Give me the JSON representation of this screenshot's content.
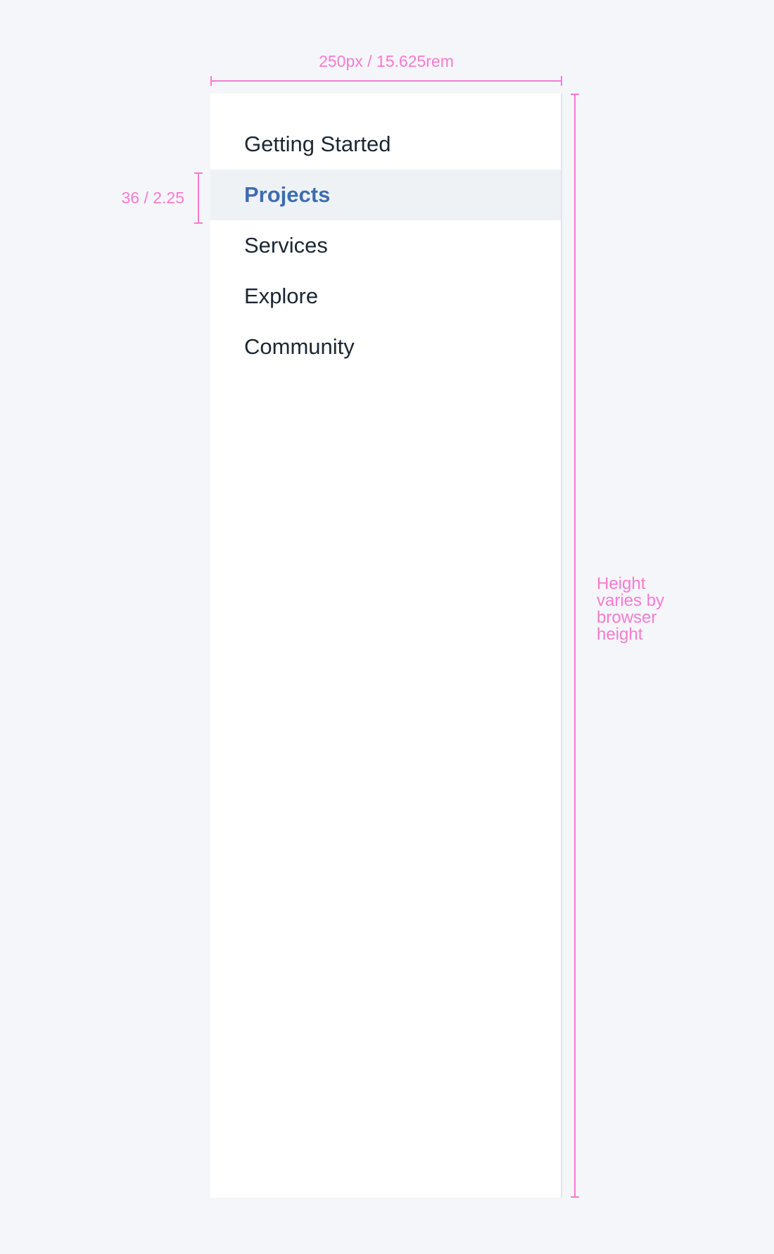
{
  "sidebar": {
    "items": [
      {
        "label": "Getting Started",
        "active": false
      },
      {
        "label": "Projects",
        "active": true
      },
      {
        "label": "Services",
        "active": false
      },
      {
        "label": "Explore",
        "active": false
      },
      {
        "label": "Community",
        "active": false
      }
    ]
  },
  "annotations": {
    "width_label": "250px / 15.625rem",
    "row_height_label": "36 / 2.25",
    "height_note": "Height varies by browser height",
    "color": "#f57bd1"
  },
  "colors": {
    "active_text": "#3e6db0",
    "active_background": "#eff2f5",
    "text": "#1b2733",
    "page_background": "#f5f6fa"
  }
}
